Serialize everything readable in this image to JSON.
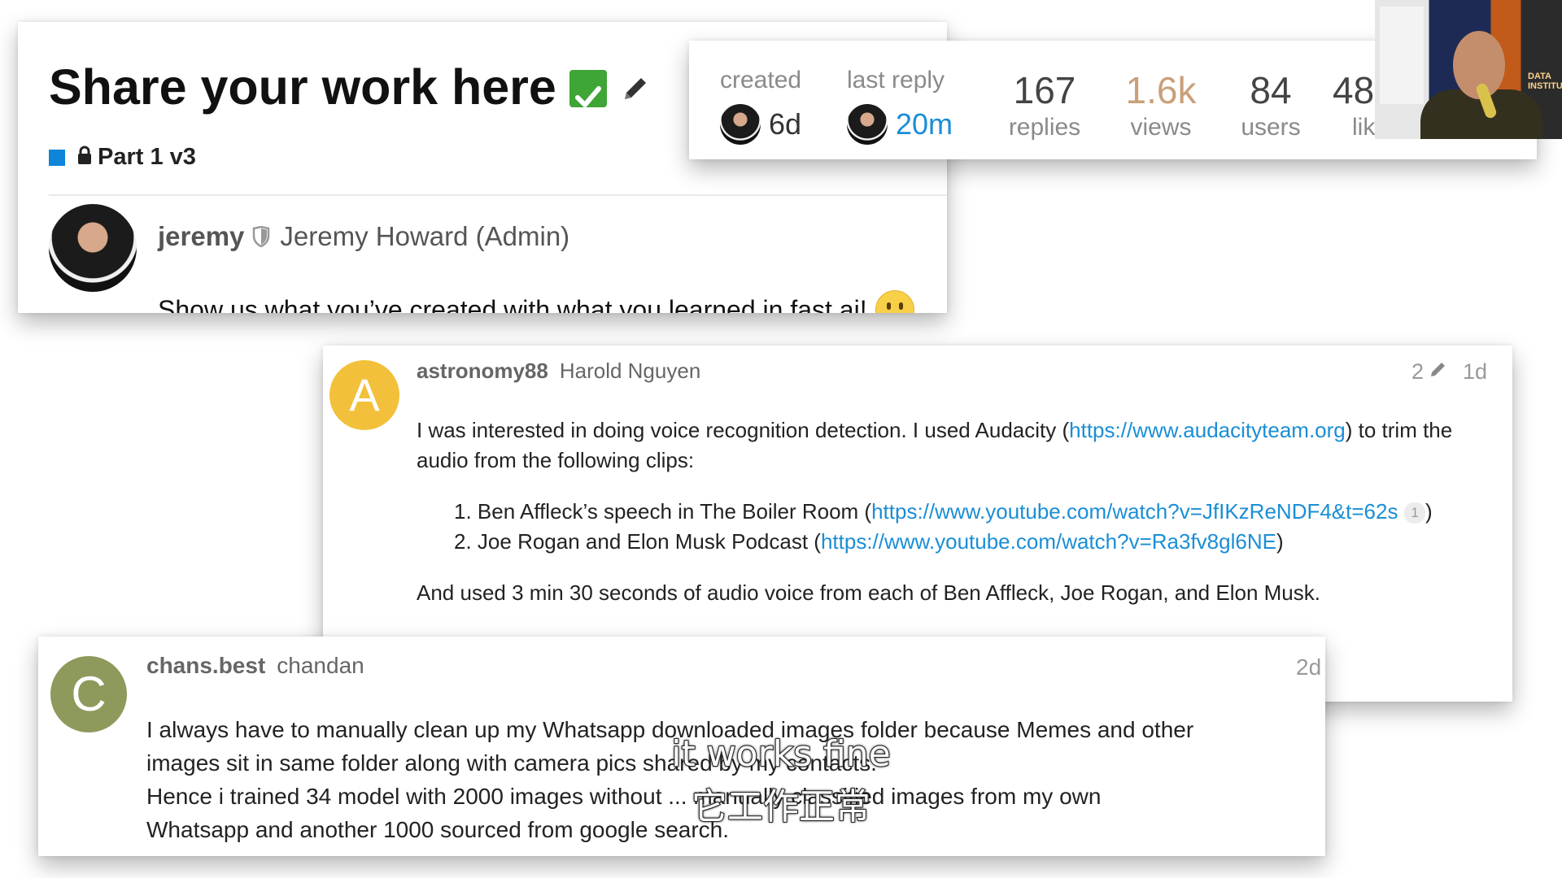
{
  "topic": {
    "title": "Share your work here",
    "category": "Part 1 v3",
    "colors": {
      "category": "#0e85d8",
      "check": "#3fa536",
      "link": "#1a8ed6"
    }
  },
  "first_post": {
    "username": "jeremy",
    "full_name": "Jeremy Howard (Admin)",
    "text": "Show us what you’ve created with what you learned in fast.ai!"
  },
  "stats": {
    "created_label": "created",
    "created_time": "6d",
    "last_reply_label": "last reply",
    "last_reply_time": "20m",
    "replies_value": "167",
    "replies_label": "replies",
    "views_value": "1.6k",
    "views_label": "views",
    "users_value": "84",
    "users_label": "users",
    "likes_value": "48",
    "likes_label": "like"
  },
  "reply1": {
    "avatar_letter": "A",
    "avatar_color": "#f2c03a",
    "username": "astronomy88",
    "full_name": "Harold Nguyen",
    "edit_count": "2",
    "age": "1d",
    "intro_before": "I was interested in doing voice recognition detection. I used Audacity (",
    "intro_link": "https://www.audacityteam.org",
    "intro_after": ") to trim the",
    "intro_line2": "audio from the following clips:",
    "items": [
      {
        "num": "1.",
        "text": "Ben Affleck’s speech in The Boiler Room (",
        "link": "https://www.youtube.com/watch?v=JfIKzReNDF4&t=62s",
        "clicks": "1",
        "close": ")"
      },
      {
        "num": "2.",
        "text": "Joe Rogan and Elon Musk Podcast (",
        "link": "https://www.youtube.com/watch?v=Ra3fv8gl6NE",
        "close": ")"
      }
    ],
    "closing": "And used 3 min 30 seconds of audio voice from each of Ben Affleck, Joe Rogan, and Elon Musk."
  },
  "reply2": {
    "avatar_letter": "C",
    "avatar_color": "#8e9a5c",
    "username": "chans.best",
    "full_name": "chandan",
    "age": "2d",
    "lines": [
      "I always have to manually clean up my Whatsapp downloaded images folder because Memes and other",
      "images sit in same folder along with camera pics shared by my contacts.",
      "Hence i trained 34 model with 2000 images without ... manually classified images from my own",
      "Whatsapp and another 1000 sourced from google search."
    ]
  },
  "subtitles": {
    "english": "it works fine",
    "chinese": "它工作正常"
  },
  "webcam": {
    "sign_text": "DATA INSTITUTE"
  }
}
